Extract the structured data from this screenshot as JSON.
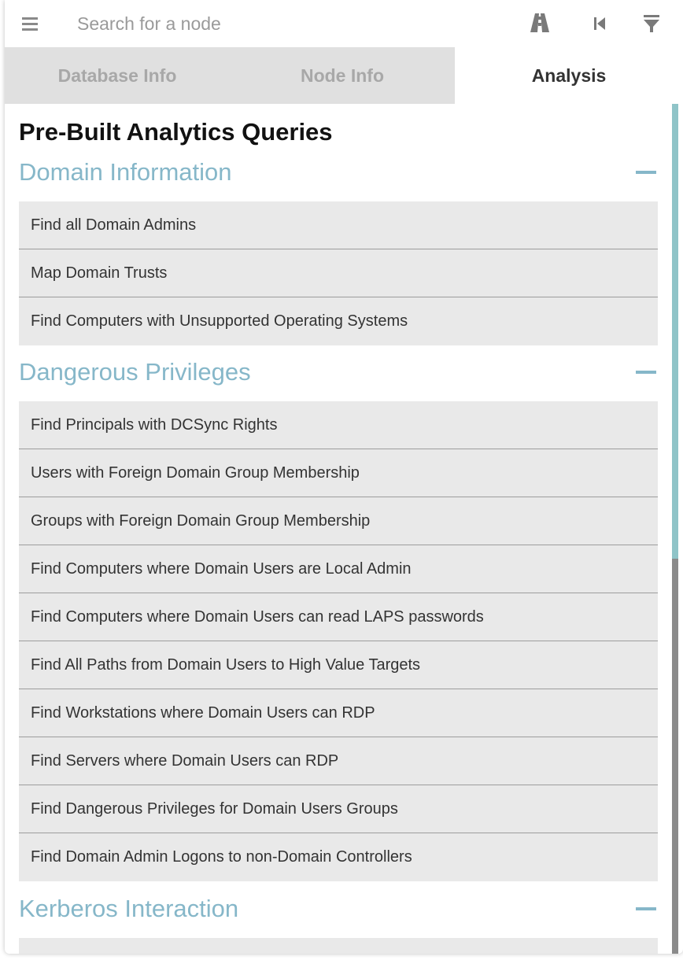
{
  "search": {
    "placeholder": "Search for a node"
  },
  "tabs": [
    {
      "label": "Database Info"
    },
    {
      "label": "Node Info"
    },
    {
      "label": "Analysis"
    }
  ],
  "heading": "Pre-Built Analytics Queries",
  "sections": [
    {
      "title": "Domain Information",
      "items": [
        "Find all Domain Admins",
        "Map Domain Trusts",
        "Find Computers with Unsupported Operating Systems"
      ]
    },
    {
      "title": "Dangerous Privileges",
      "items": [
        "Find Principals with DCSync Rights",
        "Users with Foreign Domain Group Membership",
        "Groups with Foreign Domain Group Membership",
        "Find Computers where Domain Users are Local Admin",
        "Find Computers where Domain Users can read LAPS passwords",
        "Find All Paths from Domain Users to High Value Targets",
        "Find Workstations where Domain Users can RDP",
        "Find Servers where Domain Users can RDP",
        "Find Dangerous Privileges for Domain Users Groups",
        "Find Domain Admin Logons to non-Domain Controllers"
      ]
    },
    {
      "title": "Kerberos Interaction",
      "items": [
        ""
      ]
    }
  ],
  "colors": {
    "accent": "#86b7c9",
    "tab_inactive_bg": "#e0e0e0",
    "item_bg": "#e9e9e9"
  },
  "icons": [
    "menu-icon",
    "pathfinding-icon",
    "back-icon",
    "filter-icon",
    "collapse-icon"
  ]
}
